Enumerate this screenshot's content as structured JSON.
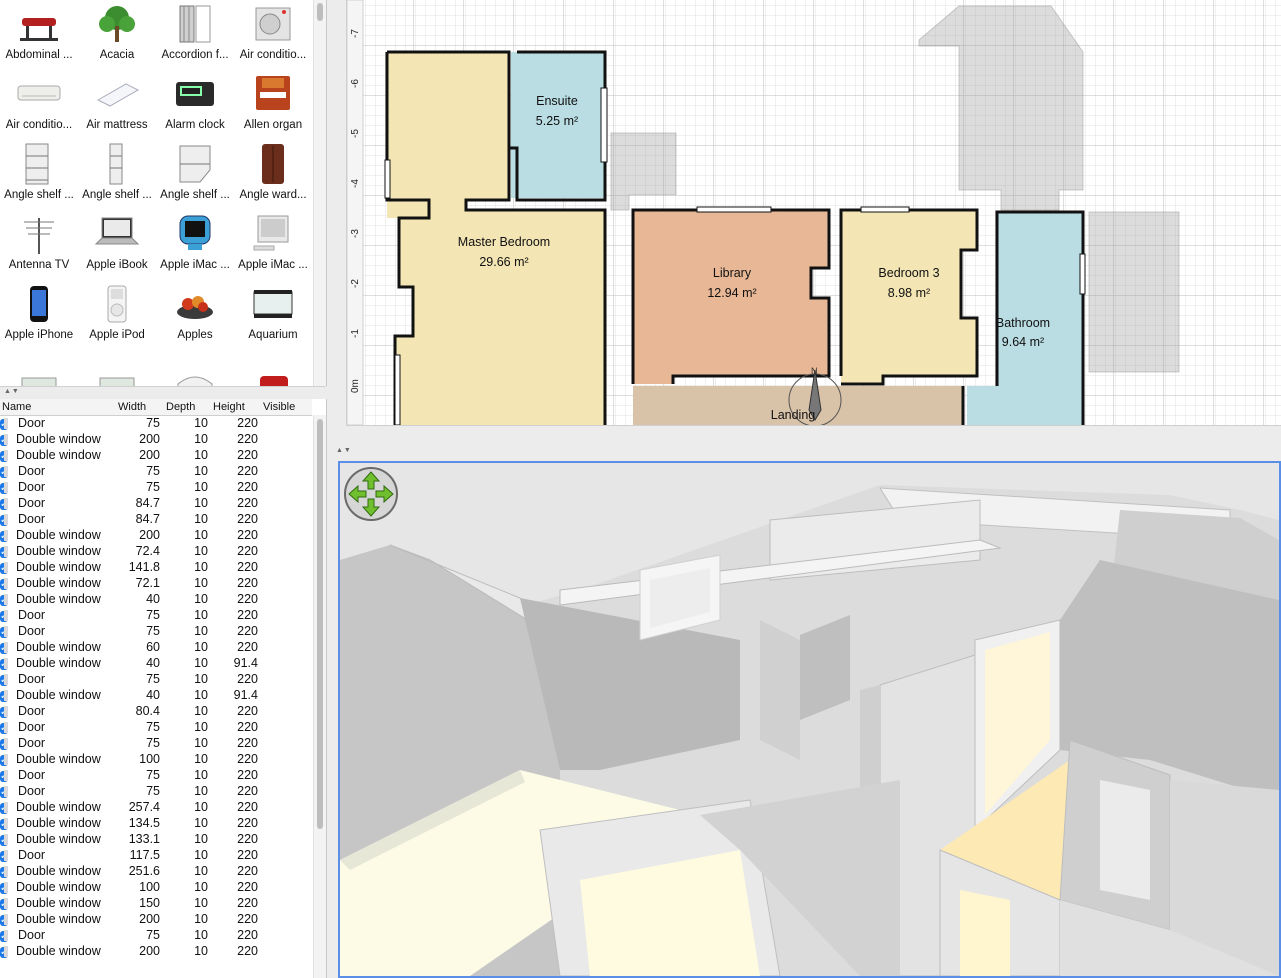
{
  "catalog": {
    "items": [
      {
        "label": "Abdominal ...",
        "icon": "abdominal-bench-icon"
      },
      {
        "label": "Acacia",
        "icon": "acacia-tree-icon"
      },
      {
        "label": "Accordion f...",
        "icon": "accordion-door-icon"
      },
      {
        "label": "Air conditio...",
        "icon": "air-conditioner-outdoor-icon"
      },
      {
        "label": "Air conditio...",
        "icon": "air-conditioner-indoor-icon"
      },
      {
        "label": "Air mattress",
        "icon": "air-mattress-icon"
      },
      {
        "label": "Alarm clock",
        "icon": "alarm-clock-icon"
      },
      {
        "label": "Allen organ",
        "icon": "organ-icon"
      },
      {
        "label": "Angle shelf ...",
        "icon": "angle-shelf-icon"
      },
      {
        "label": "Angle shelf ...",
        "icon": "angle-shelf-narrow-icon"
      },
      {
        "label": "Angle shelf ...",
        "icon": "angle-shelf-corner-icon"
      },
      {
        "label": "Angle ward...",
        "icon": "angle-wardrobe-icon"
      },
      {
        "label": "Antenna TV",
        "icon": "antenna-icon"
      },
      {
        "label": "Apple iBook",
        "icon": "laptop-icon"
      },
      {
        "label": "Apple iMac ...",
        "icon": "imac-g3-icon"
      },
      {
        "label": "Apple iMac ...",
        "icon": "imac-icon"
      },
      {
        "label": "Apple iPhone",
        "icon": "iphone-icon"
      },
      {
        "label": "Apple iPod",
        "icon": "ipod-icon"
      },
      {
        "label": "Apples",
        "icon": "apples-bowl-icon"
      },
      {
        "label": "Aquarium",
        "icon": "aquarium-icon"
      },
      {
        "label": "",
        "icon": "partial-item-icon"
      },
      {
        "label": "",
        "icon": "partial-item-icon"
      },
      {
        "label": "",
        "icon": "partial-arch-icon"
      },
      {
        "label": "",
        "icon": "partial-armchair-icon"
      }
    ]
  },
  "furniture_table": {
    "columns": [
      "Name",
      "Width",
      "Depth",
      "Height",
      "Visible"
    ],
    "rows": [
      [
        "Door",
        "75",
        "10",
        "220"
      ],
      [
        "Double window",
        "200",
        "10",
        "220"
      ],
      [
        "Double window",
        "200",
        "10",
        "220"
      ],
      [
        "Door",
        "75",
        "10",
        "220"
      ],
      [
        "Door",
        "75",
        "10",
        "220"
      ],
      [
        "Door",
        "84.7",
        "10",
        "220"
      ],
      [
        "Door",
        "84.7",
        "10",
        "220"
      ],
      [
        "Double window",
        "200",
        "10",
        "220"
      ],
      [
        "Double window",
        "72.4",
        "10",
        "220"
      ],
      [
        "Double window",
        "141.8",
        "10",
        "220"
      ],
      [
        "Double window",
        "72.1",
        "10",
        "220"
      ],
      [
        "Double window",
        "40",
        "10",
        "220"
      ],
      [
        "Door",
        "75",
        "10",
        "220"
      ],
      [
        "Door",
        "75",
        "10",
        "220"
      ],
      [
        "Double window",
        "60",
        "10",
        "220"
      ],
      [
        "Double window",
        "40",
        "10",
        "91.4"
      ],
      [
        "Door",
        "75",
        "10",
        "220"
      ],
      [
        "Double window",
        "40",
        "10",
        "91.4"
      ],
      [
        "Door",
        "80.4",
        "10",
        "220"
      ],
      [
        "Door",
        "75",
        "10",
        "220"
      ],
      [
        "Door",
        "75",
        "10",
        "220"
      ],
      [
        "Double window",
        "100",
        "10",
        "220"
      ],
      [
        "Door",
        "75",
        "10",
        "220"
      ],
      [
        "Door",
        "75",
        "10",
        "220"
      ],
      [
        "Double window",
        "257.4",
        "10",
        "220"
      ],
      [
        "Double window",
        "134.5",
        "10",
        "220"
      ],
      [
        "Double window",
        "133.1",
        "10",
        "220"
      ],
      [
        "Door",
        "117.5",
        "10",
        "220"
      ],
      [
        "Double window",
        "251.6",
        "10",
        "220"
      ],
      [
        "Double window",
        "100",
        "10",
        "220"
      ],
      [
        "Double window",
        "150",
        "10",
        "220"
      ],
      [
        "Double window",
        "200",
        "10",
        "220"
      ],
      [
        "Door",
        "75",
        "10",
        "220"
      ],
      [
        "Double window",
        "200",
        "10",
        "220"
      ]
    ],
    "visible_mark": "✓"
  },
  "plan": {
    "ruler_labels": [
      "-7",
      "-6",
      "-5",
      "-4",
      "-3",
      "-2",
      "-1",
      "0m"
    ],
    "rooms": [
      {
        "name": "Ensuite",
        "area": "5.25 m²"
      },
      {
        "name": "Master Bedroom",
        "area": "29.66 m²"
      },
      {
        "name": "Library",
        "area": "12.94 m²"
      },
      {
        "name": "Bedroom 3",
        "area": "8.98 m²"
      },
      {
        "name": "Bathroom",
        "area": "9.64 m²"
      },
      {
        "name": "Landing",
        "area": ""
      }
    ],
    "compass_letter": "N"
  },
  "colors": {
    "room_yellow": "#f3e6b4",
    "room_blue": "#b9dde3",
    "room_orange": "#e8b896",
    "room_tan": "#d8c2a8",
    "selection_blue": "#5b8ee6",
    "checkbox_blue": "#1a78e8"
  }
}
